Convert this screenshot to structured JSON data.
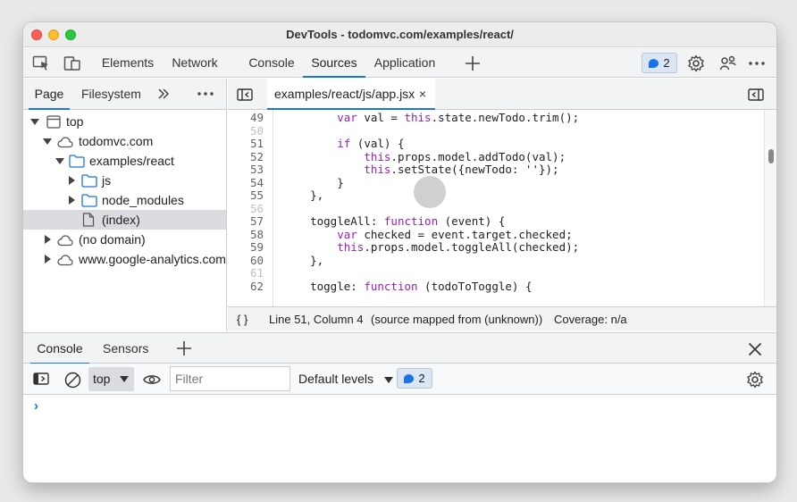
{
  "window": {
    "title": "DevTools - todomvc.com/examples/react/"
  },
  "main_tabs": [
    {
      "label": "Elements"
    },
    {
      "label": "Network"
    },
    {
      "label": "Console"
    },
    {
      "label": "Sources"
    },
    {
      "label": "Application"
    }
  ],
  "active_main_tab": "Sources",
  "issues_badge": {
    "count": "2"
  },
  "sidebar": {
    "tabs": [
      {
        "label": "Page"
      },
      {
        "label": "Filesystem"
      }
    ],
    "active_tab": "Page",
    "tree": [
      {
        "label": "top",
        "depth": 0,
        "icon": "frame-icon",
        "expanded": true
      },
      {
        "label": "todomvc.com",
        "depth": 1,
        "icon": "cloud-icon",
        "expanded": true
      },
      {
        "label": "examples/react",
        "depth": 2,
        "icon": "folder-icon",
        "expanded": true
      },
      {
        "label": "js",
        "depth": 3,
        "icon": "folder-icon",
        "expanded": false
      },
      {
        "label": "node_modules",
        "depth": 3,
        "icon": "folder-icon",
        "expanded": false
      },
      {
        "label": "(index)",
        "depth": 3,
        "icon": "file-icon",
        "selected": true
      },
      {
        "label": "(no domain)",
        "depth": 1,
        "icon": "cloud-icon",
        "expanded": false
      },
      {
        "label": "www.google-analytics.com",
        "depth": 1,
        "icon": "cloud-icon",
        "expanded": false
      }
    ]
  },
  "editor": {
    "open_file": "examples/react/js/app.jsx",
    "close_glyph": "×",
    "lines": [
      {
        "n": "49",
        "code": "        var val = this.state.newTodo.trim();"
      },
      {
        "n": "50",
        "code": ""
      },
      {
        "n": "51",
        "code": "        if (val) {"
      },
      {
        "n": "52",
        "code": "            this.props.model.addTodo(val);"
      },
      {
        "n": "53",
        "code": "            this.setState({newTodo: ''});"
      },
      {
        "n": "54",
        "code": "        }"
      },
      {
        "n": "55",
        "code": "    },"
      },
      {
        "n": "56",
        "code": ""
      },
      {
        "n": "57",
        "code": "    toggleAll: function (event) {"
      },
      {
        "n": "58",
        "code": "        var checked = event.target.checked;"
      },
      {
        "n": "59",
        "code": "        this.props.model.toggleAll(checked);"
      },
      {
        "n": "60",
        "code": "    },"
      },
      {
        "n": "61",
        "code": ""
      },
      {
        "n": "62",
        "code": "    toggle: function (todoToToggle) {"
      }
    ],
    "status": {
      "braces": "{ }",
      "position": "Line 51, Column 4",
      "source_map": "(source mapped from (unknown))",
      "coverage": "Coverage: n/a"
    }
  },
  "drawer": {
    "tabs": [
      {
        "label": "Console"
      },
      {
        "label": "Sensors"
      }
    ],
    "active_tab": "Console",
    "context": "top",
    "filter_placeholder": "Filter",
    "levels": "Default levels",
    "issues_count": "2",
    "prompt": "›"
  },
  "colors": {
    "accent": "#1a73e8",
    "keyword": "#9a1eb8"
  }
}
